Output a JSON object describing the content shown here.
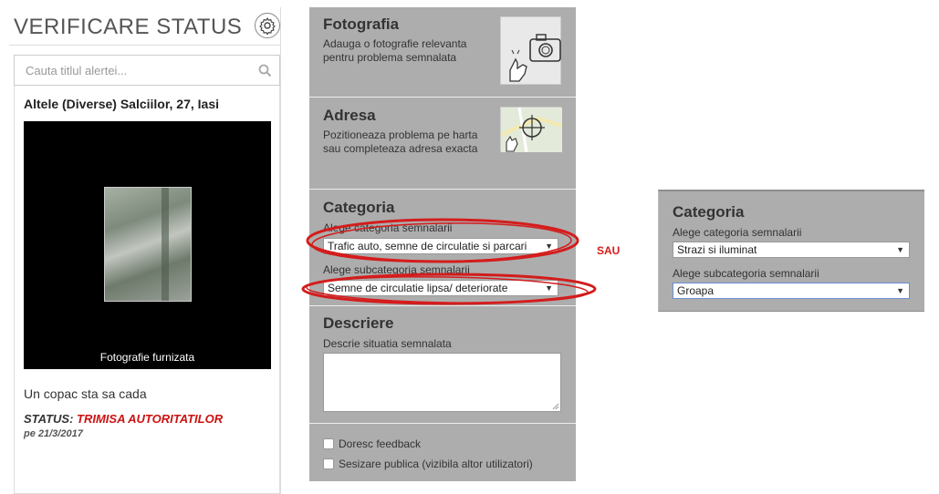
{
  "left": {
    "title": "VERIFICARE STATUS",
    "search_placeholder": "Cauta titlul alertei...",
    "alert_title": "Altele (Diverse) Salciilor, 27, Iasi",
    "photo_caption": "Fotografie furnizata",
    "description": "Un copac sta sa cada",
    "status_label": "STATUS:",
    "status_value": "TRIMISA AUTORITATILOR",
    "status_date": "pe 21/3/2017"
  },
  "form": {
    "fotografia": {
      "title": "Fotografia",
      "text": "Adauga o fotografie relevanta pentru problema semnalata"
    },
    "adresa": {
      "title": "Adresa",
      "text": "Pozitioneaza problema pe harta sau completeaza adresa exacta"
    },
    "categoria": {
      "title": "Categoria",
      "category_label": "Alege categoria semnalarii",
      "category_value": "Trafic auto, semne de circulatie si parcari",
      "subcategory_label": "Alege subcategoria semnalarii",
      "subcategory_value": "Semne de circulatie lipsa/ deteriorate"
    },
    "descriere": {
      "title": "Descriere",
      "label": "Descrie situatia semnalata"
    },
    "options": {
      "feedback": "Doresc feedback",
      "public": "Sesizare publica (vizibila altor utilizatori)"
    }
  },
  "annotation": {
    "sau": "SAU",
    "color": "#d41c1c"
  },
  "alternative": {
    "title": "Categoria",
    "category_label": "Alege categoria semnalarii",
    "category_value": "Strazi si iluminat",
    "subcategory_label": "Alege subcategoria semnalarii",
    "subcategory_value": "Groapa"
  },
  "icons": {
    "arrow": "▼"
  }
}
